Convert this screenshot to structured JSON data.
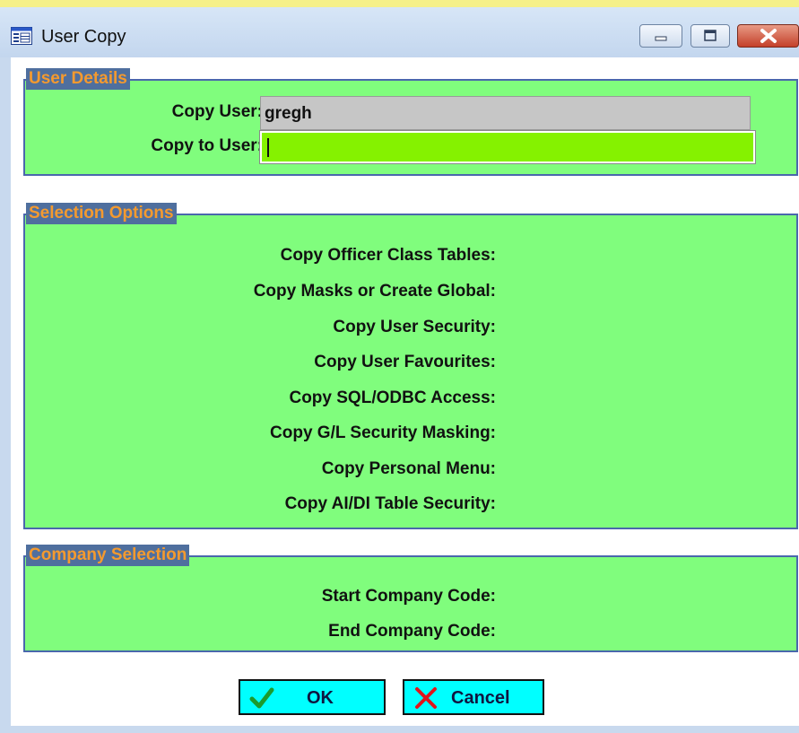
{
  "window": {
    "title": "User Copy",
    "icon": "form-window-icon",
    "controls": [
      "minimize-icon",
      "maximize-icon",
      "close-icon"
    ]
  },
  "colors": {
    "panel_bg": "#80fd7d",
    "legend_bg": "#4f6f9e",
    "legend_text": "#f49a2f",
    "group_border": "#4a67ac",
    "readonly_field": "#c6c6c6",
    "active_field": "#85f200",
    "button_bg": "#00ffff"
  },
  "user_details": {
    "legend": "User Details",
    "copy_user_label": "Copy User:",
    "copy_user_value": "gregh",
    "copy_to_user_label": "Copy to User:",
    "copy_to_user_value": ""
  },
  "selection_options": {
    "legend": "Selection Options",
    "items": [
      {
        "label": "Copy Officer Class Tables:"
      },
      {
        "label": "Copy Masks or Create Global:"
      },
      {
        "label": "Copy User Security:"
      },
      {
        "label": "Copy User Favourites:"
      },
      {
        "label": "Copy SQL/ODBC Access:"
      },
      {
        "label": "Copy G/L Security Masking:"
      },
      {
        "label": "Copy Personal Menu:"
      },
      {
        "label": "Copy AI/DI Table Security:"
      }
    ]
  },
  "company_selection": {
    "legend": "Company Selection",
    "start_label": "Start Company Code:",
    "end_label": "End Company Code:"
  },
  "buttons": {
    "ok_label": "OK",
    "ok_icon": "checkmark-icon",
    "cancel_label": "Cancel",
    "cancel_icon": "x-icon"
  }
}
